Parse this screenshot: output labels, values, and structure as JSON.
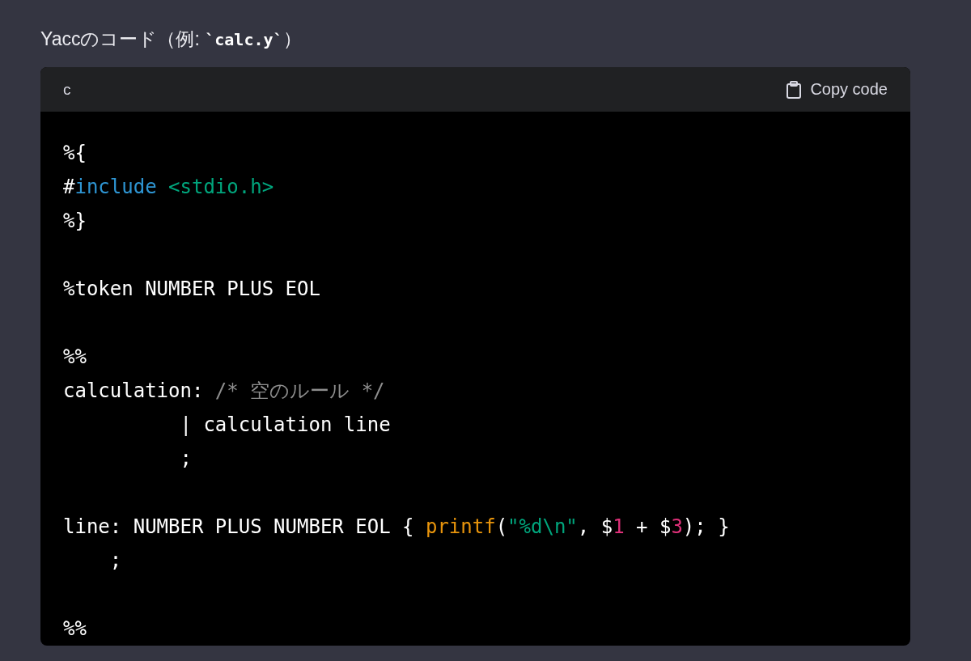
{
  "heading": [
    {
      "kind": "plain",
      "text": "Yaccのコード（例: "
    },
    {
      "kind": "code",
      "text": "`calc.y`"
    },
    {
      "kind": "plain",
      "text": "）"
    }
  ],
  "code_block": {
    "language": "c",
    "copy_button": "Copy code",
    "lines": [
      {
        "kind": "code",
        "tokens": [
          {
            "kind": "plain",
            "text": "%{"
          }
        ]
      },
      {
        "kind": "code",
        "tokens": [
          {
            "kind": "plain",
            "text": "#"
          },
          {
            "kind": "keyword",
            "text": "include"
          },
          {
            "kind": "string",
            "text": " <stdio.h>"
          }
        ]
      },
      {
        "kind": "code",
        "tokens": [
          {
            "kind": "plain",
            "text": "%}"
          }
        ]
      },
      {
        "kind": "blank"
      },
      {
        "kind": "code",
        "tokens": [
          {
            "kind": "plain",
            "text": "%token NUMBER PLUS EOL"
          }
        ]
      },
      {
        "kind": "blank"
      },
      {
        "kind": "code",
        "tokens": [
          {
            "kind": "plain",
            "text": "%%"
          }
        ]
      },
      {
        "kind": "code",
        "tokens": [
          {
            "kind": "plain",
            "text": "calculation: "
          },
          {
            "kind": "comment",
            "text": "/* 空のルール */"
          }
        ]
      },
      {
        "kind": "code",
        "tokens": [
          {
            "kind": "plain",
            "text": "          | calculation line"
          }
        ]
      },
      {
        "kind": "code",
        "tokens": [
          {
            "kind": "plain",
            "text": "          ;"
          }
        ]
      },
      {
        "kind": "blank"
      },
      {
        "kind": "code",
        "tokens": [
          {
            "kind": "plain",
            "text": "line: NUMBER PLUS NUMBER EOL { "
          },
          {
            "kind": "function",
            "text": "printf"
          },
          {
            "kind": "plain",
            "text": "("
          },
          {
            "kind": "string",
            "text": "\"%d\\n\""
          },
          {
            "kind": "plain",
            "text": ", $"
          },
          {
            "kind": "number",
            "text": "1"
          },
          {
            "kind": "plain",
            "text": " + $"
          },
          {
            "kind": "number",
            "text": "3"
          },
          {
            "kind": "plain",
            "text": "); }"
          }
        ]
      },
      {
        "kind": "code",
        "tokens": [
          {
            "kind": "plain",
            "text": "    ;"
          }
        ]
      },
      {
        "kind": "blank"
      },
      {
        "kind": "code",
        "tokens": [
          {
            "kind": "plain",
            "text": "%%"
          }
        ]
      }
    ]
  }
}
